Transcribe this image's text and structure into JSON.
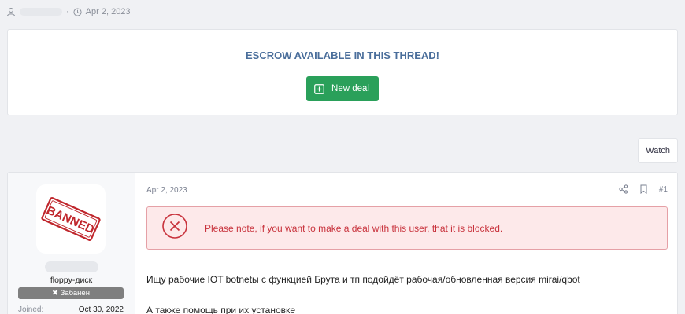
{
  "meta": {
    "date": "Apr 2, 2023",
    "user_icon": "user-icon",
    "clock_icon": "clock-icon"
  },
  "escrow": {
    "title": "ESCROW AVAILABLE IN THIS THREAD!",
    "button_label": "New deal",
    "button_icon": "plus-square-icon",
    "button_color": "#2aa05a",
    "title_color": "#4a6e9b"
  },
  "toolbar": {
    "watch_label": "Watch"
  },
  "post": {
    "user": {
      "avatar_text": "BANNED",
      "username": "floppy-диск",
      "badge": "Забанен",
      "joined_label": "Joined:",
      "joined_value": "Oct 30, 2022"
    },
    "date": "Apr 2, 2023",
    "number": "#1",
    "alert": {
      "text": "Please note, if you want to make a deal with this user, that it is blocked.",
      "icon": "x-circle-icon",
      "color": "#c8323c"
    },
    "body": [
      "Ищу рабочие IOT botnetы с функцией Брута и тп подойдёт рабочая/обновленная версия mirai/qbot",
      "А также помощь при их установке"
    ]
  }
}
